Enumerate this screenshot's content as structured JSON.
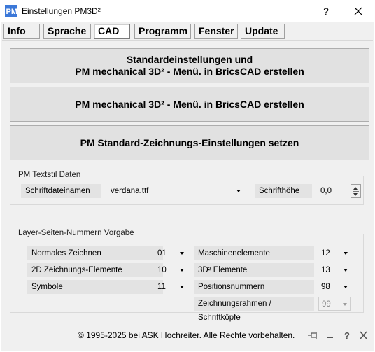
{
  "window": {
    "title": "Einstellungen PM3D²",
    "help_label": "?"
  },
  "tabs": [
    {
      "label": "Info"
    },
    {
      "label": "Sprache"
    },
    {
      "label": "CAD",
      "active": true
    },
    {
      "label": "Programm"
    },
    {
      "label": "Fenster"
    },
    {
      "label": "Update"
    }
  ],
  "cad": {
    "buttons": {
      "b1_line1": "Standardeinstellungen und",
      "b1_line2": "PM mechanical 3D² - Menü. in BricsCAD erstellen",
      "b2": "PM mechanical 3D² - Menü. in BricsCAD erstellen",
      "b3": "PM Standard-Zeichnungs-Einstellungen setzen"
    },
    "textstil": {
      "legend": "PM Textstil Daten",
      "font_label": "Schriftdateinamen",
      "font_value": "verdana.ttf",
      "height_label": "Schrifthöhe",
      "height_value": "0,0"
    },
    "layer": {
      "legend": "Layer-Seiten-Nummern Vorgabe",
      "left": [
        {
          "label": "Normales Zeichnen",
          "value": "01"
        },
        {
          "label": "2D Zeichnungs-Elemente",
          "value": "10"
        },
        {
          "label": "Symbole",
          "value": "11"
        }
      ],
      "right": [
        {
          "label": "Maschinenelemente",
          "value": "12"
        },
        {
          "label": "3D² Elemente",
          "value": "13"
        },
        {
          "label": "Positionsnummern",
          "value": "98"
        },
        {
          "label": "Zeichnungsrahmen / Schriftköpfe",
          "value": "99",
          "disabled": true
        }
      ]
    }
  },
  "statusbar": {
    "copyright": "© 1995-2025 bei ASK Hochreiter. Alle Rechte vorbehalten."
  },
  "colors": {
    "window_bg": "#f0f0f0",
    "button_bg": "#e1e1e1",
    "label_bg": "#e3e3e3",
    "icon_blue": "#3c78d8"
  }
}
